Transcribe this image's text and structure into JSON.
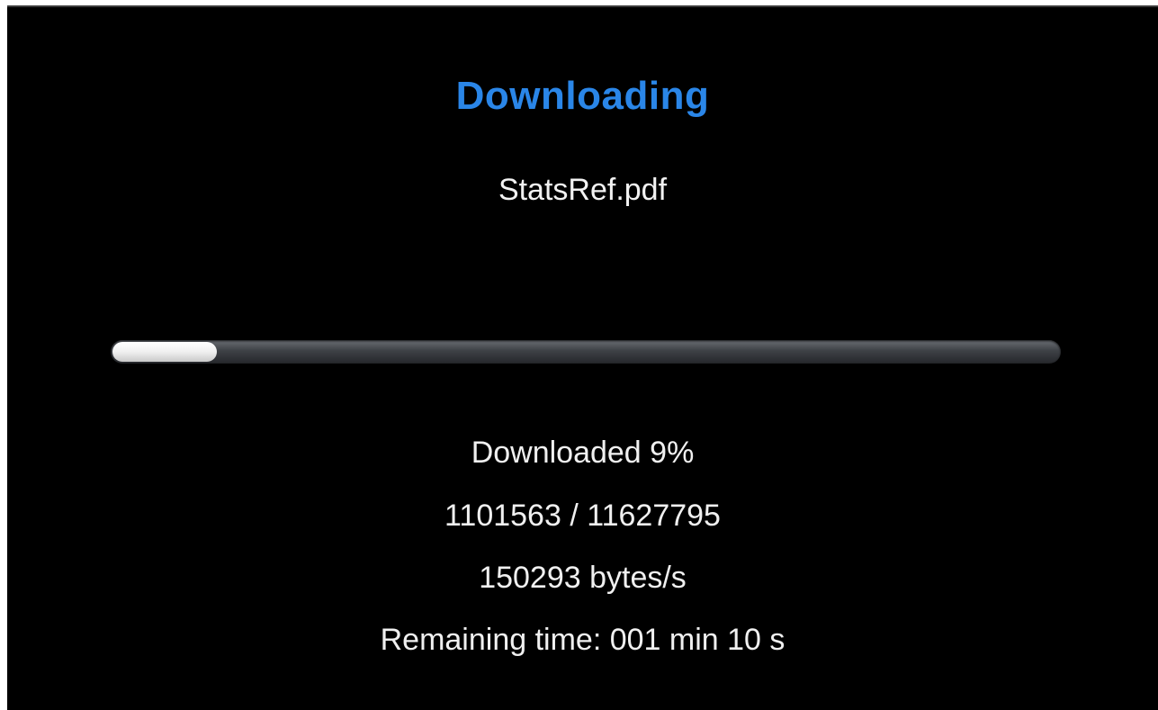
{
  "dialog": {
    "title": "Downloading",
    "filename": "StatsRef.pdf",
    "progress_fraction": 0.09,
    "downloaded_text": "Downloaded 9%",
    "bytes_text": "1101563 / 11627795",
    "rate_text": "150293 bytes/s",
    "remaining_text": "Remaining time: 001 min 10 s"
  },
  "colors": {
    "title": "#2a86e8",
    "background": "#000000",
    "text": "#f0f0f0"
  }
}
